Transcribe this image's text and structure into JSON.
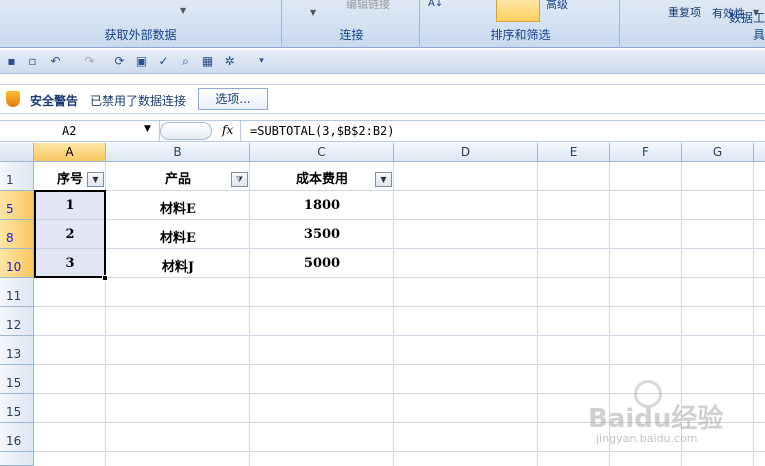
{
  "ribbon": {
    "groups": [
      {
        "label": "获取外部数据"
      },
      {
        "label": "连接"
      },
      {
        "label": "排序和筛选"
      },
      {
        "label": "数据工具"
      }
    ],
    "edit_links": "编辑链接",
    "advanced": "高级",
    "remove_duplicates": "重复项",
    "validation": "有效性"
  },
  "security_bar": {
    "title": "安全警告",
    "message": "已禁用了数据连接",
    "options_button": "选项..."
  },
  "formula_bar": {
    "name_box": "A2",
    "fx_label": "fx",
    "formula": "=SUBTOTAL(3,$B$2:B2)"
  },
  "grid": {
    "columns": [
      "A",
      "B",
      "C",
      "D",
      "E",
      "F",
      "G"
    ],
    "rows": [
      "1",
      "5",
      "8",
      "10",
      "11",
      "12",
      "13",
      "15",
      "15",
      "16"
    ],
    "header": {
      "a": "序号",
      "b": "产品",
      "c": "成本费用"
    },
    "data": [
      {
        "a": "1",
        "b": "材料E",
        "c": "1800"
      },
      {
        "a": "2",
        "b": "材料E",
        "c": "3500"
      },
      {
        "a": "3",
        "b": "材料J",
        "c": "5000"
      }
    ]
  },
  "watermark": {
    "text": "Baidu经验",
    "sub": "jingyan.baidu.com"
  },
  "colors": {
    "selection_header": "#f8c862",
    "filtered_row": "#2020c8",
    "ribbon_text": "#15428b"
  }
}
